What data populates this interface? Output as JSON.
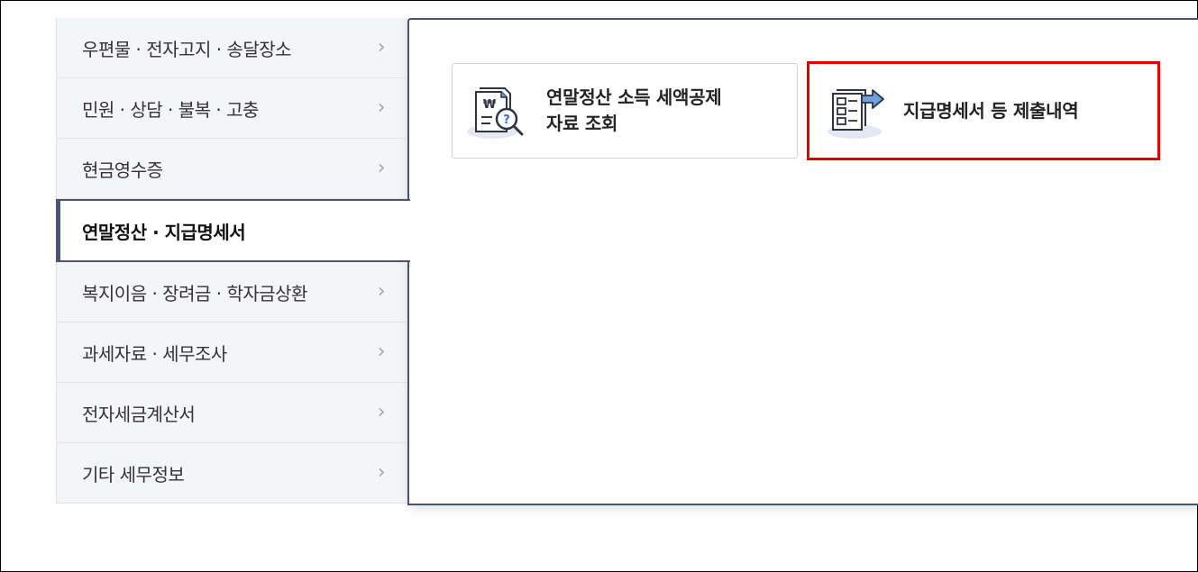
{
  "sidebar": {
    "items": [
      {
        "label": "우편물 · 전자고지 · 송달장소",
        "chevron": "›",
        "active": false
      },
      {
        "label": "민원 · 상담 · 불복 · 고충",
        "chevron": "›",
        "active": false
      },
      {
        "label": "현금영수증",
        "chevron": "›",
        "active": false
      },
      {
        "label": "연말정산 · 지급명세서",
        "chevron": "",
        "active": true
      },
      {
        "label": "복지이음 · 장려금 · 학자금상환",
        "chevron": "›",
        "active": false
      },
      {
        "label": "과세자료 · 세무조사",
        "chevron": "›",
        "active": false
      },
      {
        "label": "전자세금계산서",
        "chevron": "›",
        "active": false
      },
      {
        "label": "기타 세무정보",
        "chevron": "›",
        "active": false
      }
    ]
  },
  "content": {
    "cards": [
      {
        "line1": "연말정산 소득 세액공제",
        "line2": "자료 조회",
        "icon": "document-search-won-icon",
        "icon_text": "₩",
        "icon_mark": "?"
      },
      {
        "line1": "지급명세서 등 제출내역",
        "line2": "",
        "icon": "document-submit-arrow-icon"
      }
    ]
  },
  "colors": {
    "accent": "#4b5570",
    "highlight": "#e00000",
    "sidebar_bg": "#f4f5f9",
    "icon_blue": "#6e9fe0"
  }
}
